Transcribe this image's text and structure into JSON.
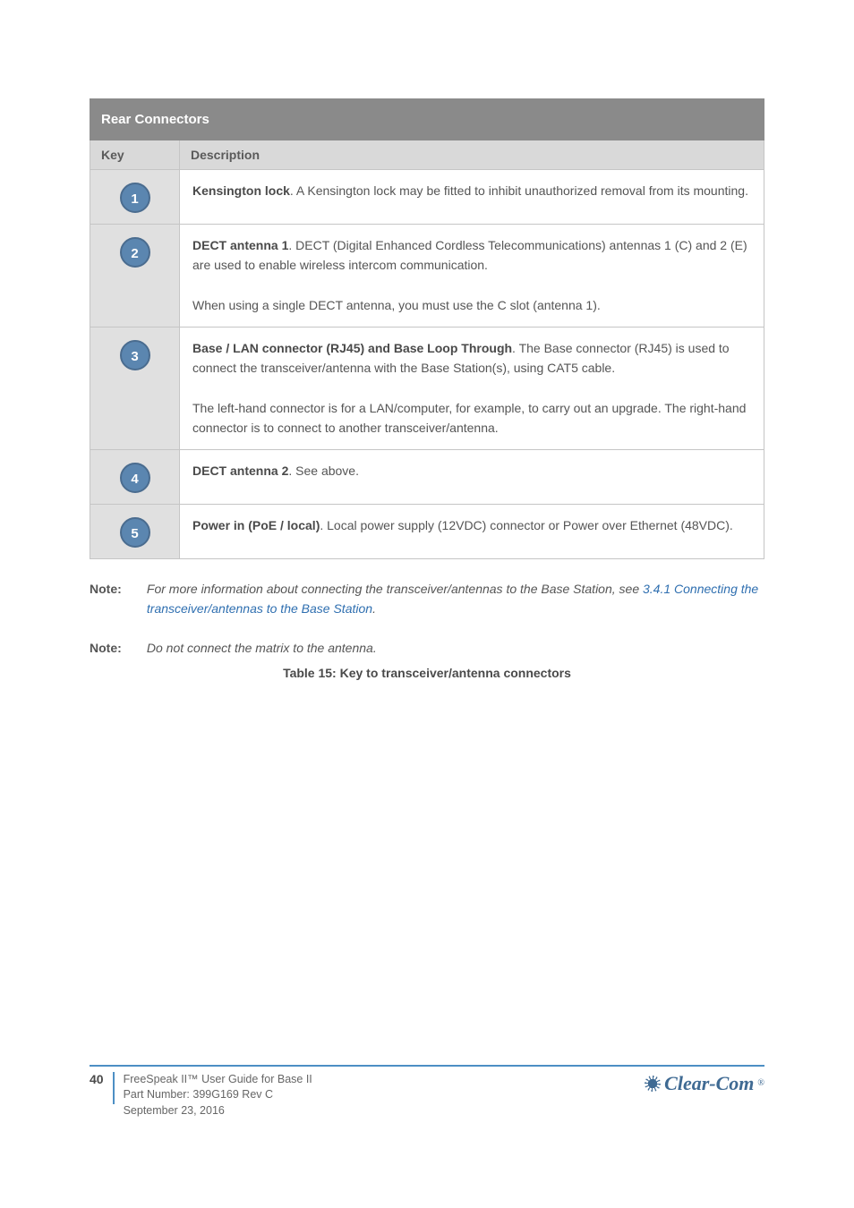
{
  "table": {
    "group_title": "Rear Connectors",
    "col_key": "Key",
    "col_desc": "Description",
    "rows": [
      {
        "num": "1",
        "label": "Kensington lock",
        "body": "A Kensington lock may be fitted to inhibit unauthorized removal from its mounting."
      },
      {
        "num": "2",
        "label": "DECT antenna 1",
        "body": "DECT (Digital Enhanced Cordless Telecommunications) antennas 1 (C) and 2 (E) are used to enable wireless intercom communication.",
        "tail": "When using a single DECT antenna, you must use the C slot (antenna 1)."
      },
      {
        "num": "3",
        "label": "Base / LAN connector (RJ45) and Base Loop Through",
        "body": "The Base connector (RJ45) is used to connect the transceiver/antenna with the Base Station(s), using CAT5 cable.",
        "tail": "The left-hand connector is for a LAN/computer, for example, to carry out an upgrade. The right-hand connector is to connect to another transceiver/antenna."
      },
      {
        "num": "4",
        "label": "DECT antenna 2",
        "body": "See above.",
        "tail": ""
      },
      {
        "num": "5",
        "label": "Power in (PoE / local)",
        "body": "Local power supply (12VDC) connector or Power over Ethernet (48VDC).",
        "tail": ""
      }
    ]
  },
  "note1": {
    "label": "Note:",
    "pre": "For more information about connecting the transceiver/antennas to the Base Station, see ",
    "xref": "3.4.1 Connecting the transceiver/antennas to the Base Station",
    "post": "."
  },
  "note2": {
    "label": "Note:",
    "pre": "Do not connect the matrix to the antenna."
  },
  "caption": "Table 15: Key to transceiver/antenna connectors",
  "footer": {
    "page": "40",
    "line1": "FreeSpeak II™ User Guide for Base II",
    "line2": "Part Number: 399G169 Rev C",
    "line3": "September 23, 2016",
    "brand": "Clear-Com"
  }
}
